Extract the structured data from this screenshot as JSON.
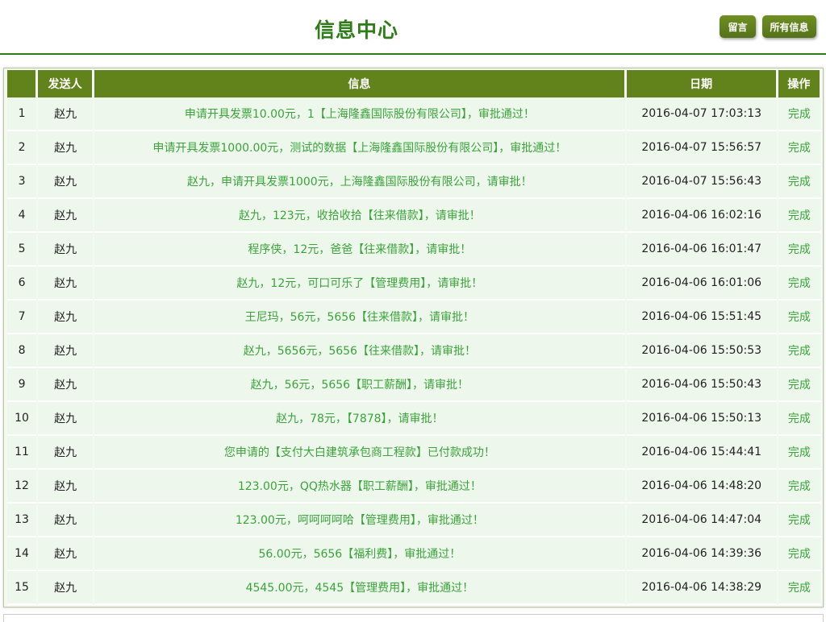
{
  "header": {
    "title": "信息中心",
    "buttons": {
      "leave_message": "留言",
      "all_messages": "所有信息"
    }
  },
  "table": {
    "columns": {
      "index": "",
      "sender": "发送人",
      "message": "信息",
      "date": "日期",
      "action": "操作"
    },
    "rows": [
      {
        "index": "1",
        "sender": "赵九",
        "message": "申请开具发票10.00元，1【上海隆鑫国际股份有限公司】，审批通过！",
        "date": "2016-04-07 17:03:13",
        "action": "完成"
      },
      {
        "index": "2",
        "sender": "赵九",
        "message": "申请开具发票1000.00元，测试的数据【上海隆鑫国际股份有限公司】，审批通过！",
        "date": "2016-04-07 15:56:57",
        "action": "完成"
      },
      {
        "index": "3",
        "sender": "赵九",
        "message": "赵九，申请开具发票1000元，上海隆鑫国际股份有限公司，请审批！",
        "date": "2016-04-07 15:56:43",
        "action": "完成"
      },
      {
        "index": "4",
        "sender": "赵九",
        "message": "赵九，123元，收拾收拾【往来借款】，请审批！",
        "date": "2016-04-06 16:02:16",
        "action": "完成"
      },
      {
        "index": "5",
        "sender": "赵九",
        "message": "程序侠，12元，爸爸【往来借款】，请审批！",
        "date": "2016-04-06 16:01:47",
        "action": "完成"
      },
      {
        "index": "6",
        "sender": "赵九",
        "message": "赵九，12元，可口可乐了【管理费用】，请审批！",
        "date": "2016-04-06 16:01:06",
        "action": "完成"
      },
      {
        "index": "7",
        "sender": "赵九",
        "message": "王尼玛，56元，5656【往来借款】，请审批！",
        "date": "2016-04-06 15:51:45",
        "action": "完成"
      },
      {
        "index": "8",
        "sender": "赵九",
        "message": "赵九，5656元，5656【往来借款】，请审批！",
        "date": "2016-04-06 15:50:53",
        "action": "完成"
      },
      {
        "index": "9",
        "sender": "赵九",
        "message": "赵九，56元，5656【职工薪酬】，请审批！",
        "date": "2016-04-06 15:50:43",
        "action": "完成"
      },
      {
        "index": "10",
        "sender": "赵九",
        "message": "赵九，78元，【7878】，请审批！",
        "date": "2016-04-06 15:50:13",
        "action": "完成"
      },
      {
        "index": "11",
        "sender": "赵九",
        "message": "您申请的【支付大白建筑承包商工程款】已付款成功！",
        "date": "2016-04-06 15:44:41",
        "action": "完成"
      },
      {
        "index": "12",
        "sender": "赵九",
        "message": "123.00元，QQ热水器【职工薪酬】，审批通过！",
        "date": "2016-04-06 14:48:20",
        "action": "完成"
      },
      {
        "index": "13",
        "sender": "赵九",
        "message": "123.00元，呵呵呵呵哈【管理费用】，审批通过！",
        "date": "2016-04-06 14:47:04",
        "action": "完成"
      },
      {
        "index": "14",
        "sender": "赵九",
        "message": "56.00元，5656【福利费】，审批通过！",
        "date": "2016-04-06 14:39:36",
        "action": "完成"
      },
      {
        "index": "15",
        "sender": "赵九",
        "message": "4545.00元，4545【管理费用】，审批通过！",
        "date": "2016-04-06 14:38:29",
        "action": "完成"
      }
    ]
  },
  "colors": {
    "header_bg": "#62831b",
    "accent_green": "#2e7d1a",
    "message_text": "#3aa43a",
    "row_bg": "#eef7ec"
  }
}
